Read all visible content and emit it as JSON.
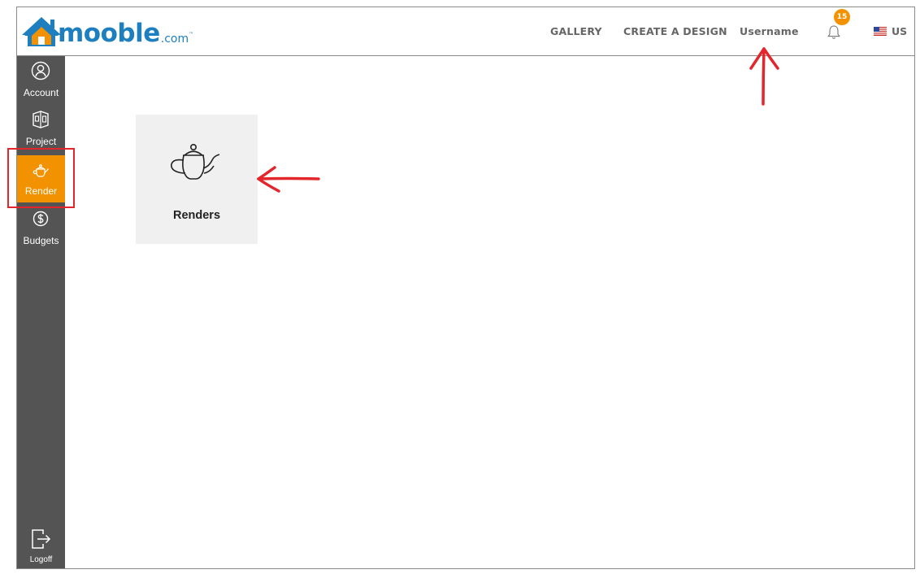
{
  "header": {
    "logo": {
      "brand": "mooble",
      "suffix": ".com",
      "tm": "™"
    },
    "nav": {
      "gallery": "GALLERY",
      "create_design": "CREATE A DESIGN",
      "username": "Username"
    },
    "notifications": {
      "icon": "bell-icon",
      "count": "15"
    },
    "language": {
      "icon": "us-flag-icon",
      "label": "US"
    }
  },
  "sidebar": {
    "items": [
      {
        "label": "Account",
        "icon": "user-circle-icon"
      },
      {
        "label": "Project",
        "icon": "room-icon"
      },
      {
        "label": "Render",
        "icon": "teapot-icon",
        "active": true
      },
      {
        "label": "Budgets",
        "icon": "dollar-circle-icon"
      }
    ],
    "logoff": {
      "label": "Logoff",
      "icon": "logout-icon"
    }
  },
  "main": {
    "card": {
      "label": "Renders",
      "icon": "teapot-icon"
    }
  },
  "colors": {
    "brand_blue": "#1d7fc0",
    "accent_orange": "#f39200",
    "sidebar_bg": "#545454",
    "annotation_red": "#e3262b"
  }
}
